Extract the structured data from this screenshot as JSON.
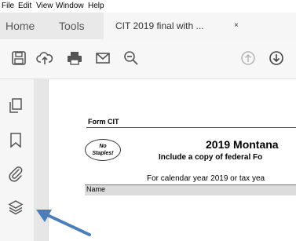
{
  "menubar": {
    "items": [
      "File",
      "Edit",
      "View",
      "Window",
      "Help"
    ]
  },
  "tabs": {
    "home": "Home",
    "tools": "Tools",
    "document": "CIT 2019 final with ...",
    "close_glyph": "×"
  },
  "toolbar": {
    "icons": [
      "save-icon",
      "upload-icon",
      "print-icon",
      "email-icon",
      "zoom-out-icon",
      "page-up-icon",
      "page-down-icon"
    ]
  },
  "sidebar": {
    "icons": [
      "pages-icon",
      "bookmark-icon",
      "attachment-icon",
      "layers-icon"
    ]
  },
  "document": {
    "form_label": "Form CIT",
    "staples_line1": "No",
    "staples_line2": "Staples!",
    "title": "2019 Montana",
    "subtitle": "Include a copy of federal Fo",
    "calendar_text": "For calendar year 2019 or tax yea",
    "name_label": "Name"
  },
  "annotation": {
    "color": "#4a7ebb"
  }
}
